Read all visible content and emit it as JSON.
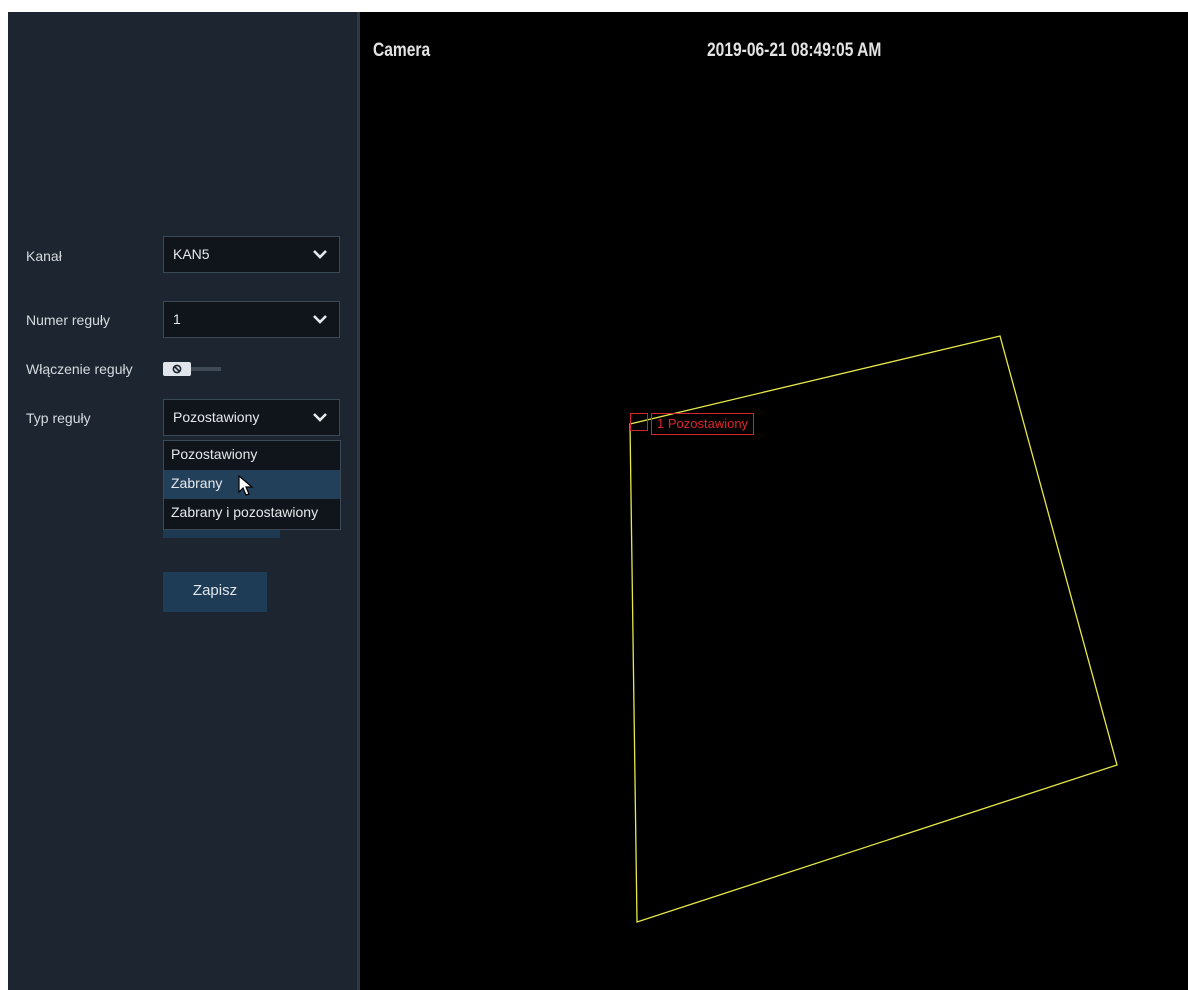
{
  "form": {
    "channel": {
      "label": "Kanał",
      "value": "KAN5"
    },
    "rule_number": {
      "label": "Numer reguły",
      "value": "1"
    },
    "rule_enable": {
      "label": "Włączenie reguły",
      "state": "off"
    },
    "rule_type": {
      "label": "Typ reguły",
      "value": "Pozostawiony",
      "options": [
        "Pozostawiony",
        "Zabrany",
        "Zabrany i pozostawiony"
      ],
      "highlighted": "Zabrany"
    },
    "save_label": "Zapisz"
  },
  "video": {
    "camera_name": "Camera",
    "timestamp": "2019-06-21 08:49:05 AM",
    "rule_tag": "1 Pozostawiony"
  },
  "colors": {
    "panel": "#1c2530",
    "video_bg": "#000000",
    "zone_line": "#e8e84a",
    "rule_tag": "#d2262a",
    "highlight": "#23405a"
  },
  "icons": [
    "chevron-down-icon",
    "toggle-off-icon",
    "cursor-arrow-icon"
  ]
}
